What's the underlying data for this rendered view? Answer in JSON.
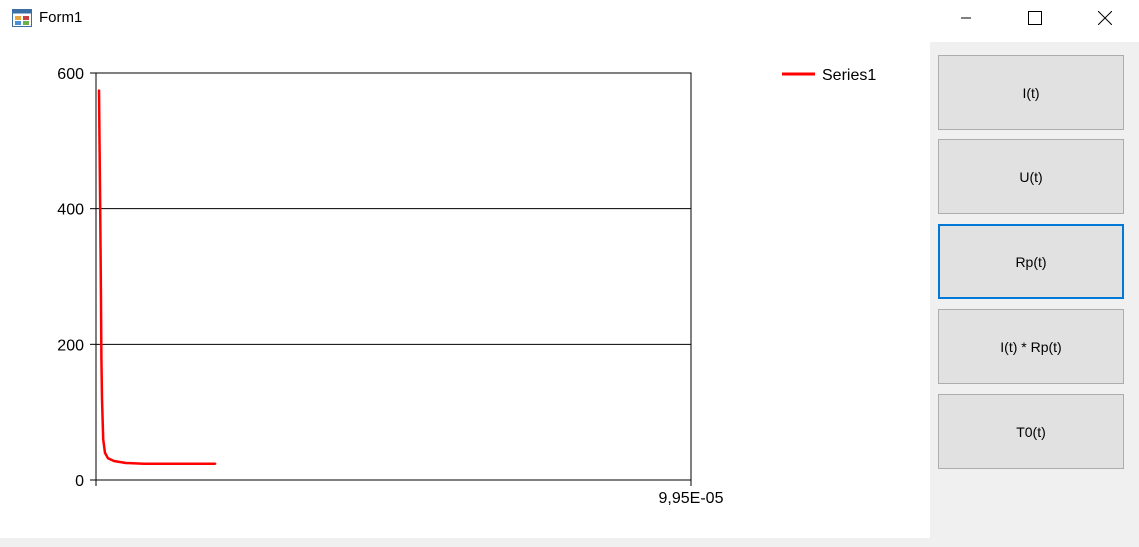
{
  "window": {
    "title": "Form1",
    "icon": "form-app-icon",
    "controls": [
      "minimize-icon",
      "maximize-icon",
      "close-icon"
    ]
  },
  "buttons": [
    {
      "label": "I(t)",
      "focused": false
    },
    {
      "label": "U(t)",
      "focused": false
    },
    {
      "label": "Rp(t)",
      "focused": true
    },
    {
      "label": "I(t) * Rp(t)",
      "focused": false
    },
    {
      "label": "T0(t)",
      "focused": false
    }
  ],
  "chart_data": {
    "type": "line",
    "title": "",
    "xlabel": "",
    "ylabel": "",
    "x_tick_labels": [
      "9,95E-05"
    ],
    "y_ticks": [
      0,
      200,
      400,
      600
    ],
    "ylim": [
      0,
      600
    ],
    "xlim": [
      0,
      9.95e-05
    ],
    "grid": "horizontal",
    "legend": "top-right",
    "series": [
      {
        "name": "Series1",
        "color": "#ff0000",
        "x": [
          5e-07,
          7e-07,
          8e-07,
          9e-07,
          1e-06,
          1.2e-06,
          1.5e-06,
          2e-06,
          3e-06,
          5e-06,
          8e-06,
          1.2e-05,
          2e-05
        ],
        "y": [
          575,
          400,
          300,
          180,
          120,
          60,
          40,
          32,
          28,
          25,
          24,
          24,
          24
        ]
      }
    ]
  }
}
